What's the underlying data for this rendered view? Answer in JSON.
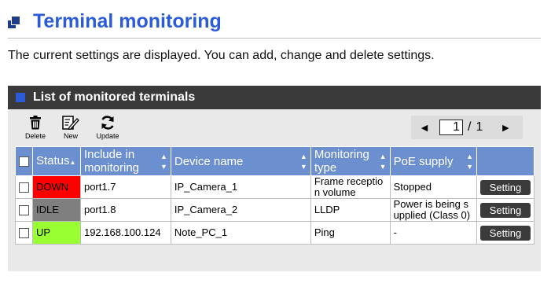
{
  "page": {
    "title": "Terminal monitoring",
    "description": "The current settings are displayed. You can add, change and delete settings."
  },
  "section": {
    "title": "List of monitored terminals"
  },
  "toolbar": {
    "delete_label": "Delete",
    "new_label": "New",
    "update_label": "Update"
  },
  "pager": {
    "current": "1",
    "separator": "/",
    "total": "1",
    "prev_icon": "triangle-left-icon",
    "next_icon": "triangle-right-icon"
  },
  "table": {
    "headers": {
      "status": "Status",
      "include": "Include in monitoring",
      "device": "Device name",
      "type": "Monitoring type",
      "poe": "PoE supply"
    },
    "rows": [
      {
        "status": "DOWN",
        "status_color": "#ff0000",
        "include": "port1.7",
        "device": "IP_Camera_1",
        "type": "Frame receptio n volume",
        "poe": "Stopped",
        "action": "Setting"
      },
      {
        "status": "IDLE",
        "status_color": "#7f7f7f",
        "include": "port1.8",
        "device": "IP_Camera_2",
        "type": "LLDP",
        "poe": "Power is being s upplied (Class 0)",
        "action": "Setting"
      },
      {
        "status": "UP",
        "status_color": "#99ff33",
        "include": "192.168.100.124",
        "device": "Note_PC_1",
        "type": "Ping",
        "poe": "-",
        "action": "Setting"
      }
    ]
  },
  "colors": {
    "title": "#2b5bd6",
    "header_bar": "#3a3a3a",
    "table_header": "#6c8fcf",
    "button": "#3b3b3b"
  }
}
